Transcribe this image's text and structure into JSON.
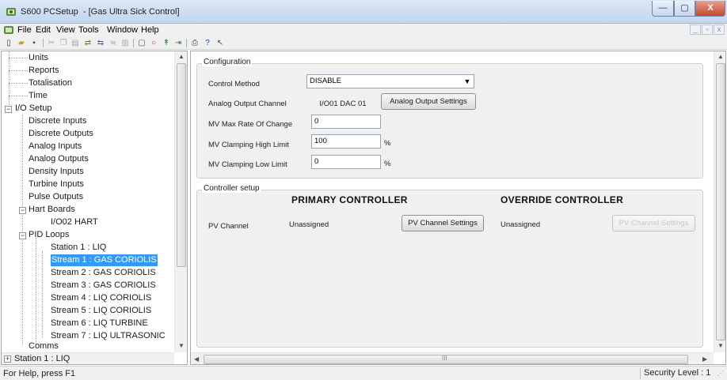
{
  "window": {
    "title": "S600 PCSetup  - [Gas Ultra Sick Control]",
    "min_glyph": "—",
    "max_glyph": "▢",
    "close_glyph": "X"
  },
  "menu": {
    "items": [
      "File",
      "Edit",
      "View",
      "Tools",
      "Window",
      "Help"
    ],
    "mdi_controls": [
      "_",
      "▫",
      "x"
    ]
  },
  "toolbar": {
    "icons": [
      "new-icon",
      "open-icon",
      "save-icon",
      "cut-icon",
      "copy-icon",
      "paste-icon",
      "connect-icon",
      "disconnect-icon",
      "compare-icon",
      "graph-icon",
      "stop-icon",
      "record-icon",
      "transfer-icon",
      "upload-icon",
      "print-icon",
      "help-icon",
      "context-help-icon"
    ]
  },
  "tree": {
    "items": [
      {
        "label": "Units",
        "level": 1
      },
      {
        "label": "Reports",
        "level": 1
      },
      {
        "label": "Totalisation",
        "level": 1
      },
      {
        "label": "Time",
        "level": 1
      },
      {
        "label": "I/O Setup",
        "level": 0,
        "expander": "−"
      },
      {
        "label": "Discrete Inputs",
        "level": 1
      },
      {
        "label": "Discrete Outputs",
        "level": 1
      },
      {
        "label": "Analog Inputs",
        "level": 1
      },
      {
        "label": "Analog Outputs",
        "level": 1
      },
      {
        "label": "Density Inputs",
        "level": 1
      },
      {
        "label": "Turbine Inputs",
        "level": 1
      },
      {
        "label": "Pulse Outputs",
        "level": 1
      },
      {
        "label": "Hart Boards",
        "level": 1,
        "expander": "−"
      },
      {
        "label": "I/O02 HART",
        "level": 2
      },
      {
        "label": "PID Loops",
        "level": 1,
        "expander": "−"
      },
      {
        "label": "Station 1 : LIQ",
        "level": 2
      },
      {
        "label": "Stream 1 : GAS CORIOLIS",
        "level": 2,
        "selected": true
      },
      {
        "label": "Stream 2 : GAS CORIOLIS",
        "level": 2
      },
      {
        "label": "Stream 3 : GAS CORIOLIS",
        "level": 2
      },
      {
        "label": "Stream 4 : LIQ CORIOLIS",
        "level": 2
      },
      {
        "label": "Stream 5 : LIQ CORIOLIS",
        "level": 2
      },
      {
        "label": "Stream 6 : LIQ TURBINE",
        "level": 2
      },
      {
        "label": "Stream 7 : LIQ ULTRASONIC",
        "level": 2
      },
      {
        "label": "Comms",
        "level": 1
      },
      {
        "label": "Station 1 : LIQ",
        "level": 0,
        "expander": "+"
      }
    ]
  },
  "configuration": {
    "group_label": "Configuration",
    "control_method_label": "Control Method",
    "control_method_value": "DISABLE",
    "analog_output_channel_label": "Analog Output Channel",
    "analog_output_channel_value": "I/O01 DAC 01",
    "analog_output_settings_button": "Analog Output Settings",
    "mv_max_rate_label": "MV Max Rate Of Change",
    "mv_max_rate_value": "0",
    "mv_clamp_high_label": "MV Clamping High Limit",
    "mv_clamp_high_value": "100",
    "mv_clamp_high_unit": "%",
    "mv_clamp_low_label": "MV Clamping Low Limit",
    "mv_clamp_low_value": "0",
    "mv_clamp_low_unit": "%"
  },
  "controller_setup": {
    "group_label": "Controller setup",
    "primary_heading": "PRIMARY CONTROLLER",
    "override_heading": "OVERRIDE CONTROLLER",
    "pv_channel_label": "PV Channel",
    "primary_pv_value": "Unassigned",
    "primary_pv_button": "PV Channel Settings",
    "override_pv_value": "Unassigned",
    "override_pv_button": "PV Channel Settings"
  },
  "scroll": {
    "hscroll_thumb_grip": "III"
  },
  "status": {
    "help_text": "For Help, press F1",
    "security_level": "Security Level : 1"
  },
  "colors": {
    "selection": "#3399ff",
    "titlebar": "#c3d6ee",
    "close_button": "#c8462d",
    "panel_bg": "#f0f0f0"
  }
}
